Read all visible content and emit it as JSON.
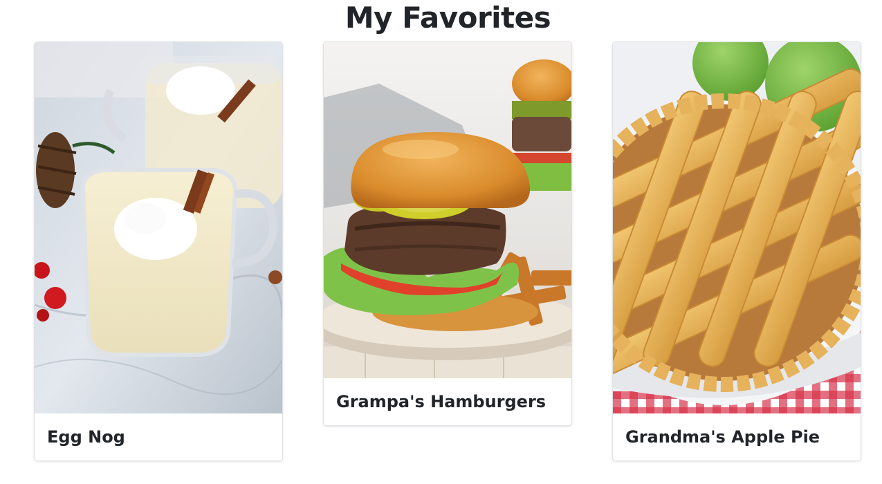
{
  "page": {
    "title": "My Favorites"
  },
  "cards": [
    {
      "title": "Egg Nog",
      "image": "egg-nog-photo"
    },
    {
      "title": "Grampa's Hamburgers",
      "image": "hamburger-photo"
    },
    {
      "title": "Grandma's Apple Pie",
      "image": "apple-pie-photo"
    }
  ],
  "colors": {
    "text": "#212529",
    "card_border": "#dfe2e6",
    "background": "#ffffff"
  }
}
